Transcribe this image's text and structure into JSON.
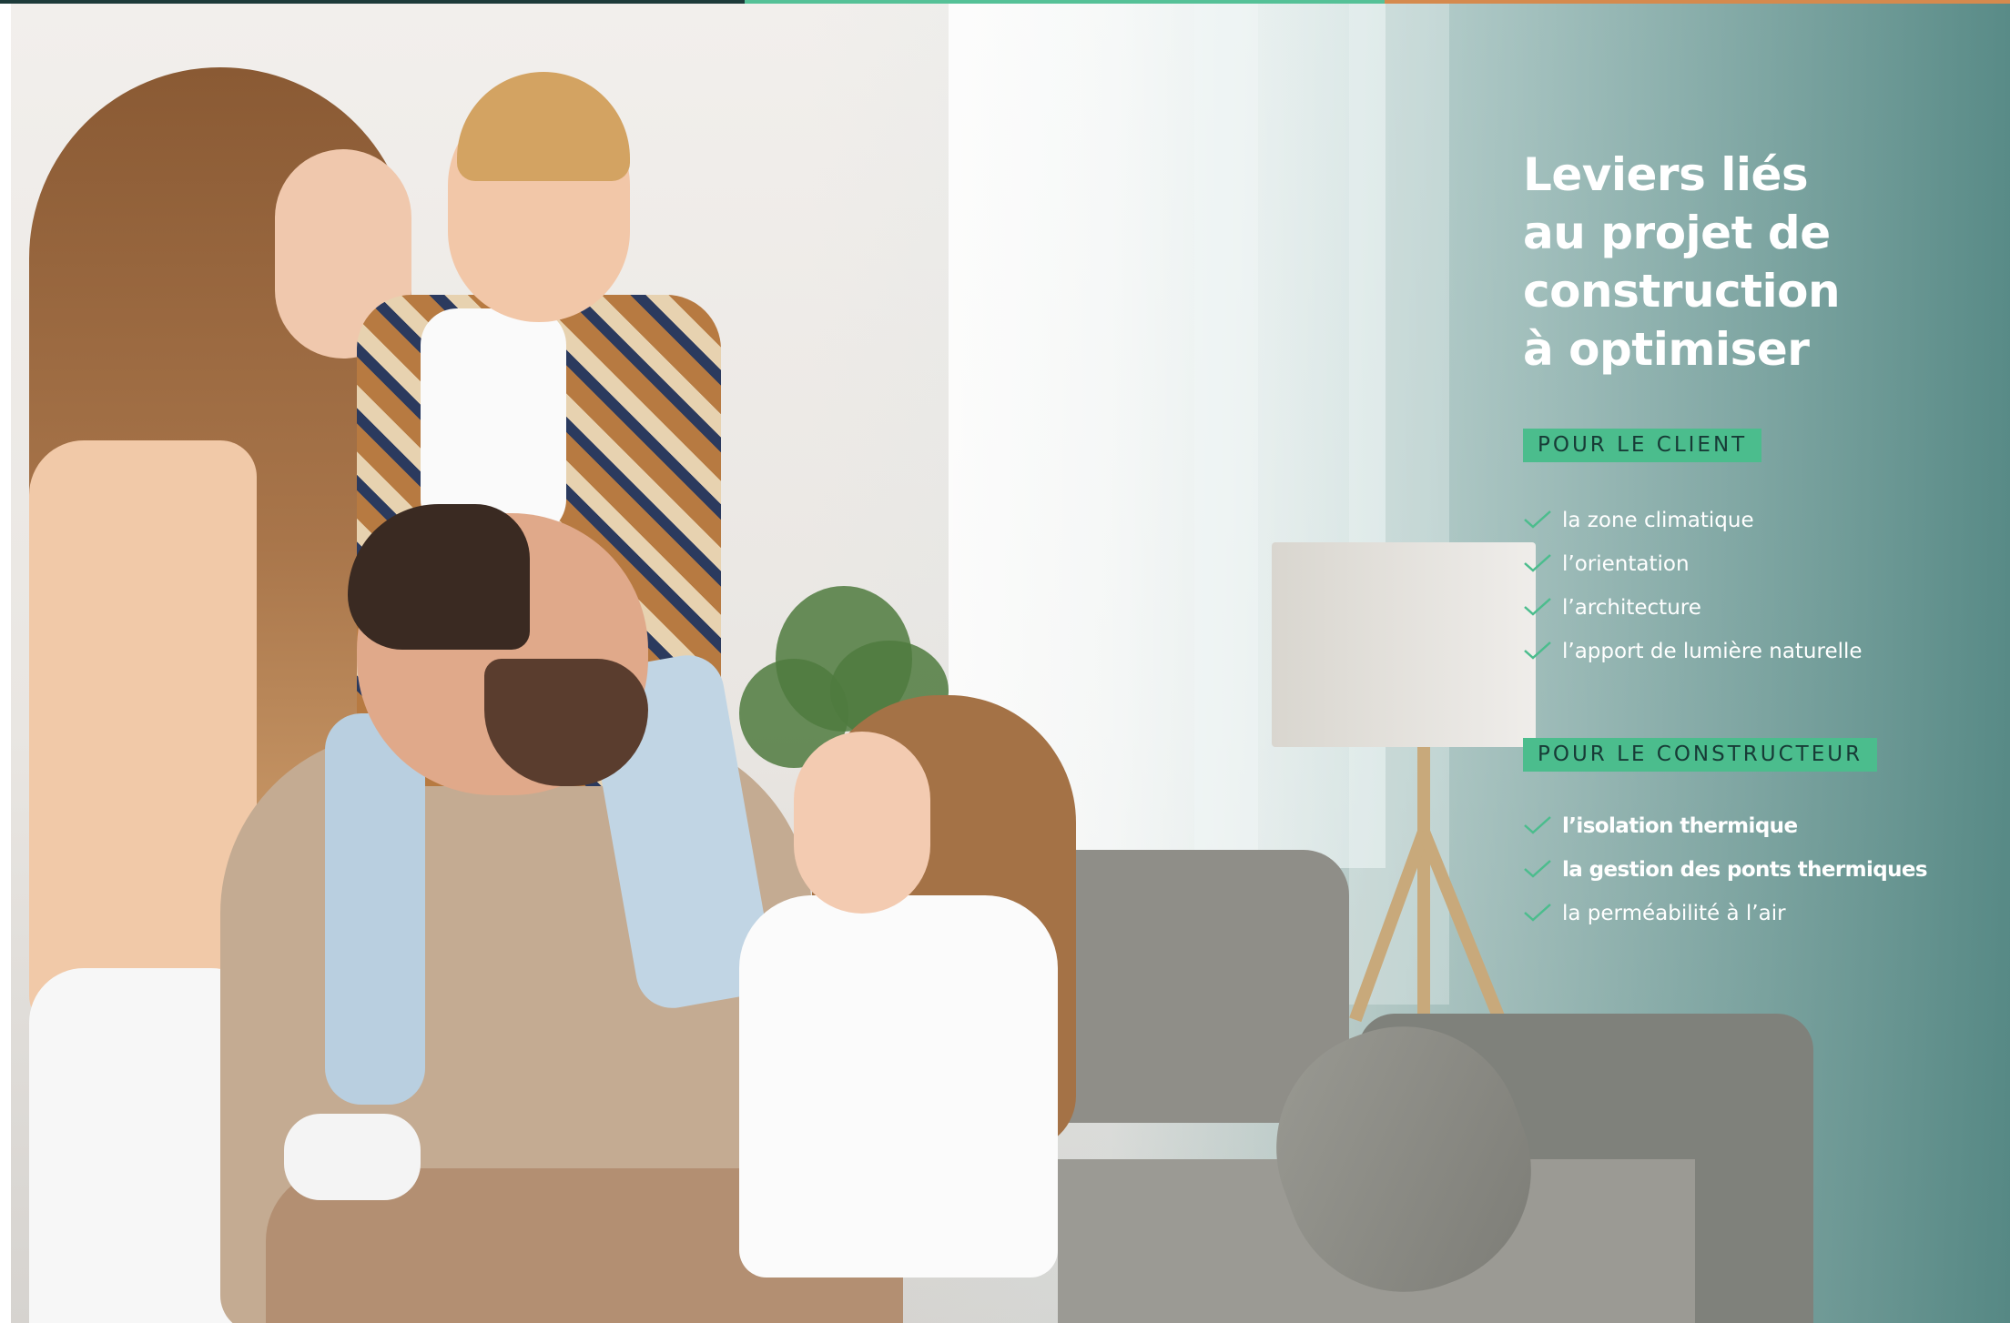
{
  "colors": {
    "accent_green": "#4bbd8d",
    "tag_text": "#173b36",
    "topbar_dark": "#1d3b3a",
    "topbar_green": "#55c197",
    "topbar_orange": "#d58a4e"
  },
  "heading": {
    "lines": [
      "Leviers liés",
      "au projet de",
      "construction",
      "à optimiser"
    ]
  },
  "client": {
    "tag": "POUR LE CLIENT",
    "items": [
      {
        "label": "la zone climatique",
        "bold": false
      },
      {
        "label": "l’orientation",
        "bold": false
      },
      {
        "label": "l’architecture",
        "bold": false
      },
      {
        "label": "l’apport de lumière naturelle",
        "bold": false
      }
    ]
  },
  "builder": {
    "tag": "POUR LE CONSTRUCTEUR",
    "items": [
      {
        "label": "l’isolation thermique",
        "bold": true
      },
      {
        "label": "la gestion des ponts thermiques",
        "bold": true
      },
      {
        "label": "la perméabilité à l’air",
        "bold": false
      }
    ]
  },
  "icons": {
    "check": "check-icon"
  }
}
